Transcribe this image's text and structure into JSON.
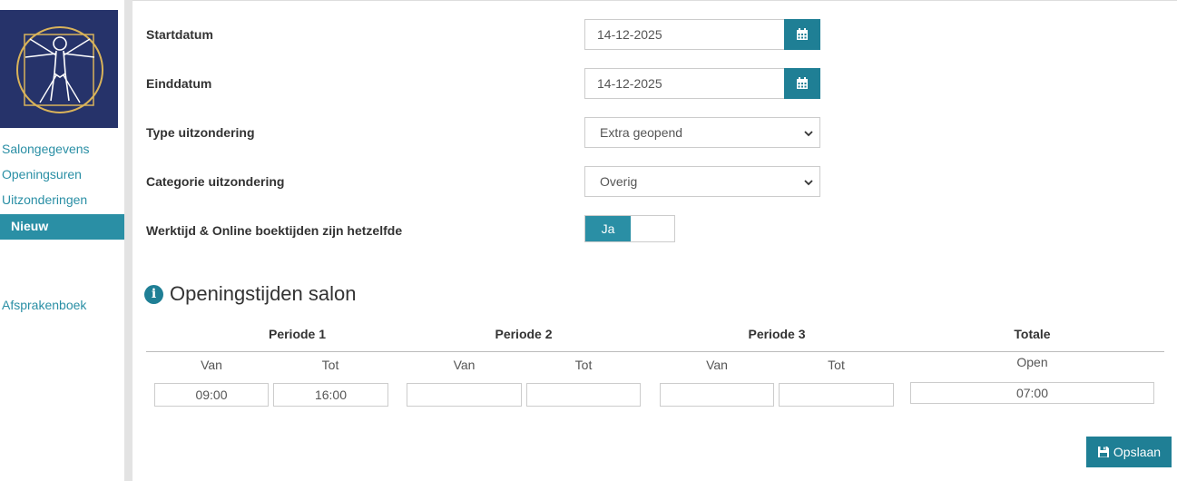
{
  "sidebar": {
    "items": [
      {
        "label": "Salongegevens"
      },
      {
        "label": "Openingsuren"
      },
      {
        "label": "Uitzonderingen"
      },
      {
        "label": "Nieuw"
      },
      {
        "label": "Afsprakenboek"
      }
    ]
  },
  "form": {
    "startdatum": {
      "label": "Startdatum",
      "value": "14-12-2025"
    },
    "einddatum": {
      "label": "Einddatum",
      "value": "14-12-2025"
    },
    "type": {
      "label": "Type uitzondering",
      "value": "Extra geopend"
    },
    "categorie": {
      "label": "Categorie uitzondering",
      "value": "Overig"
    },
    "werktijd": {
      "label": "Werktijd & Online boektijden zijn hetzelfde",
      "toggle_label": "Ja",
      "value": true
    }
  },
  "openingstijden": {
    "title": "Openingstijden salon",
    "periods": [
      "Periode 1",
      "Periode 2",
      "Periode 3"
    ],
    "total_header": "Totale",
    "van_label": "Van",
    "tot_label": "Tot",
    "open_label": "Open",
    "values": {
      "p1_van": "09:00",
      "p1_tot": "16:00",
      "p2_van": "",
      "p2_tot": "",
      "p3_van": "",
      "p3_tot": "",
      "total_open": "07:00"
    }
  },
  "save_button": {
    "label": "Opslaan"
  },
  "colors": {
    "accent": "#2a8fa5",
    "accent_dark": "#1f7f95",
    "logo_bg": "#26336a",
    "logo_gold": "#d9b35a"
  },
  "icons": [
    "vitruvian-man-logo",
    "calendar-icon",
    "chevron-down-icon",
    "info-icon",
    "floppy-disk-icon"
  ]
}
